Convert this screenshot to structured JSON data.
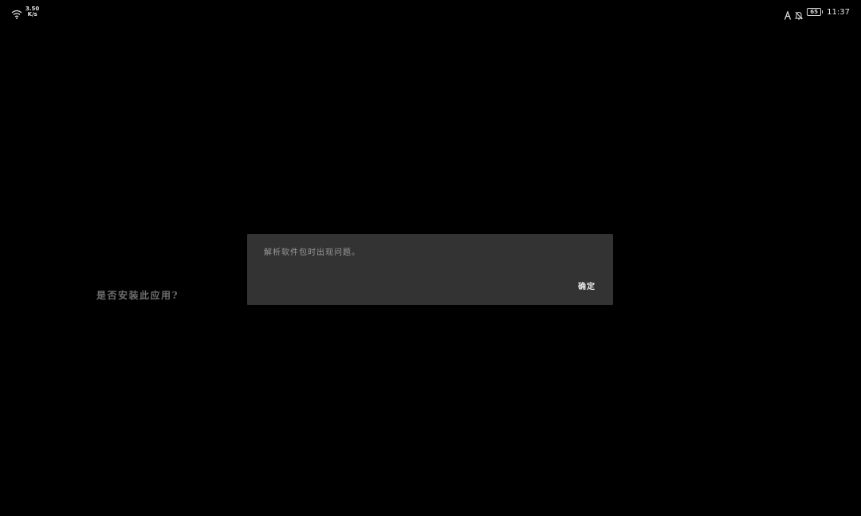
{
  "status_bar": {
    "network_speed_value": "3.50",
    "network_speed_unit": "K/s",
    "battery_level": "65",
    "time": "11:37",
    "icons": {
      "wifi": "wifi-icon",
      "a": "a-icon",
      "notification_off": "bell-off-icon",
      "battery": "battery-icon"
    }
  },
  "background": {
    "install_prompt": "是否安装此应用?"
  },
  "dialog": {
    "message": "解析软件包时出现问题。",
    "ok_label": "确定"
  },
  "colors": {
    "background": "#000000",
    "dialog_bg": "#333333",
    "dialog_text": "#9a9a9a",
    "button_text": "#e8e8e8",
    "prompt_text": "#6e6e6e"
  }
}
